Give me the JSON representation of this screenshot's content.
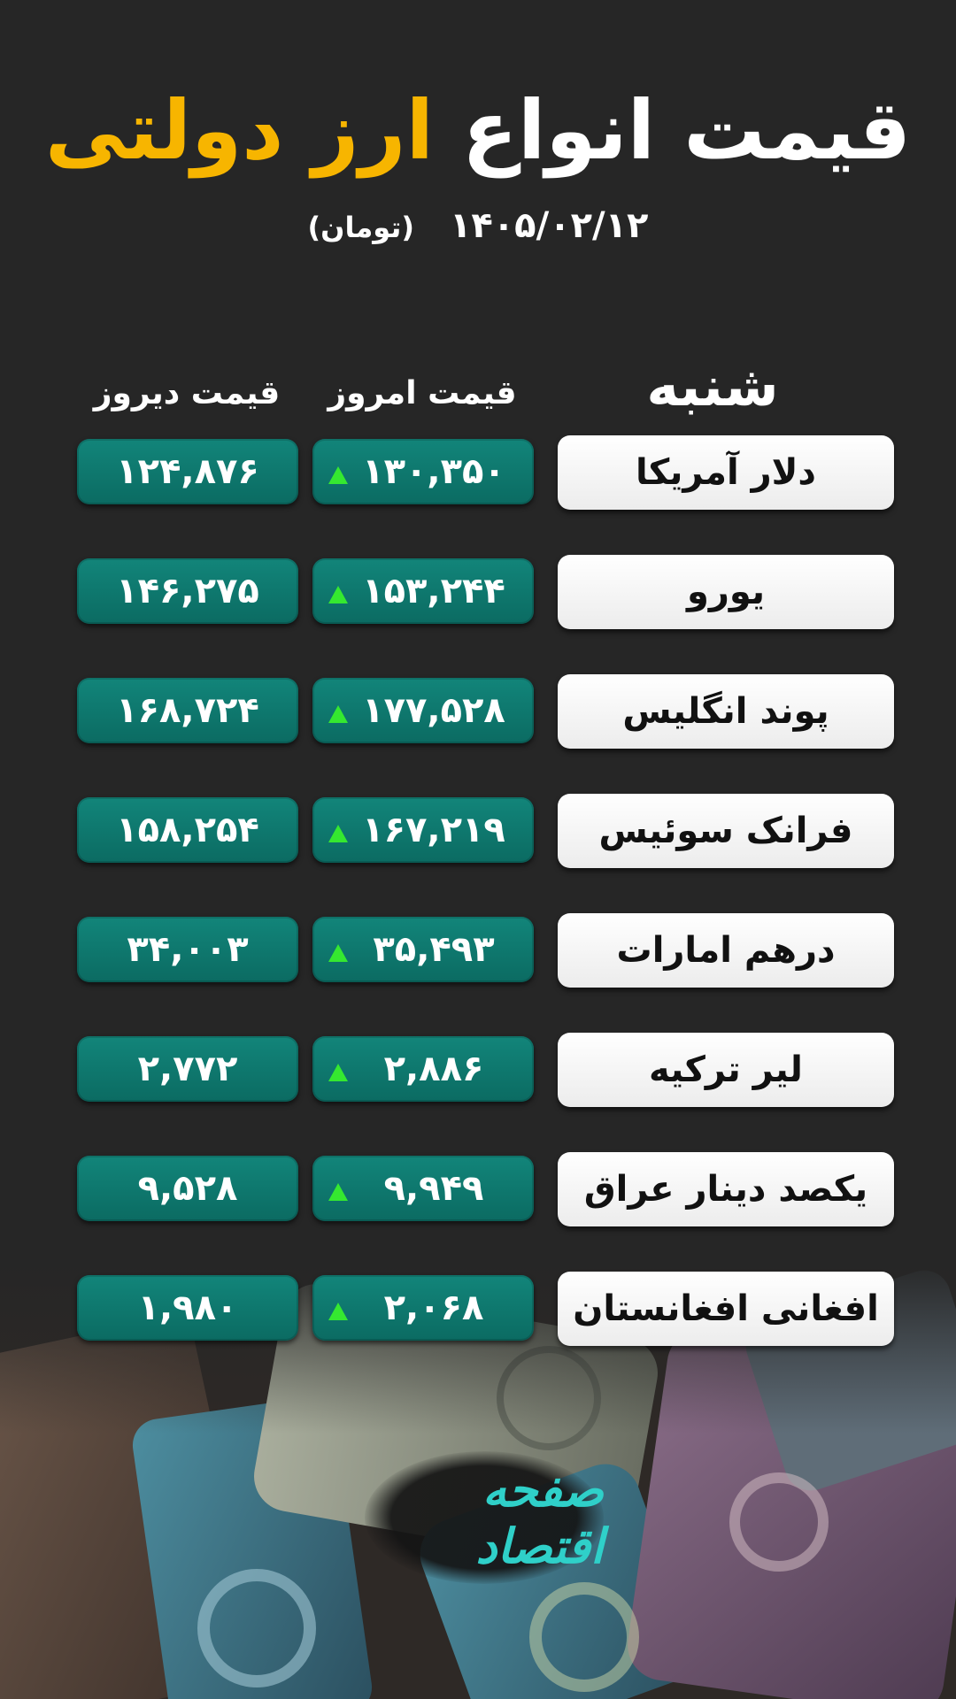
{
  "title": {
    "part1": "قیمت انواع",
    "part2": "ارز دولتی"
  },
  "subtitle": {
    "date": "۱۴۰۵/۰۲/۱۲",
    "unit": "(تومان)"
  },
  "day": "شنبه",
  "columns": {
    "today": "قیمت امروز",
    "yesterday": "قیمت دیروز"
  },
  "colors": {
    "accent": "#f7b500",
    "price_box": "#0f7a70",
    "up_arrow": "#35e830"
  },
  "rows": [
    {
      "name": "دلار آمریکا",
      "today": "۱۳۰,۳۵۰",
      "yesterday": "۱۲۴,۸۷۶",
      "trend": "up"
    },
    {
      "name": "یورو",
      "today": "۱۵۳,۲۴۴",
      "yesterday": "۱۴۶,۲۷۵",
      "trend": "up"
    },
    {
      "name": "پوند انگلیس",
      "today": "۱۷۷,۵۲۸",
      "yesterday": "۱۶۸,۷۲۴",
      "trend": "up"
    },
    {
      "name": "فرانک سوئیس",
      "today": "۱۶۷,۲۱۹",
      "yesterday": "۱۵۸,۲۵۴",
      "trend": "up"
    },
    {
      "name": "درهم امارات",
      "today": "۳۵,۴۹۳",
      "yesterday": "۳۴,۰۰۳",
      "trend": "up"
    },
    {
      "name": "لیر ترکیه",
      "today": "۲,۸۸۶",
      "yesterday": "۲,۷۷۲",
      "trend": "up"
    },
    {
      "name": "یکصد دینار عراق",
      "today": "۹,۹۴۹",
      "yesterday": "۹,۵۲۸",
      "trend": "up"
    },
    {
      "name": "افغانی افغانستان",
      "today": "۲,۰۶۸",
      "yesterday": "۱,۹۸۰",
      "trend": "up"
    }
  ],
  "logo": {
    "text": "صفحه اقتصاد"
  }
}
